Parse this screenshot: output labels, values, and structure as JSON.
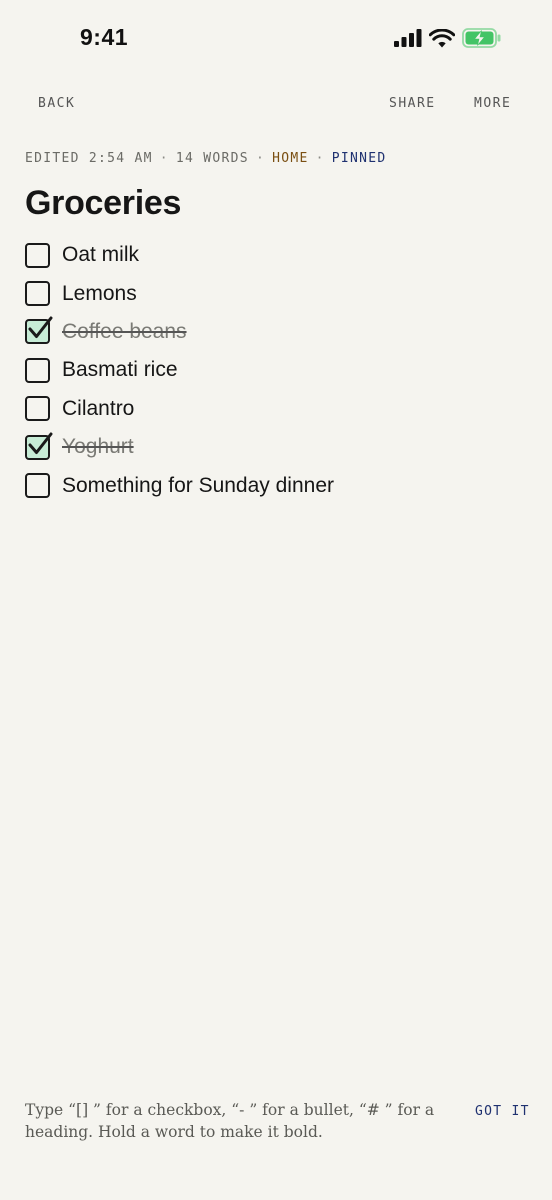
{
  "status_bar": {
    "time": "9:41",
    "battery_color": "#43c466"
  },
  "toolbar": {
    "back_label": "BACK",
    "share_label": "SHARE",
    "more_label": "MORE"
  },
  "meta": {
    "edited": "EDITED 2:54 AM",
    "separator": "·",
    "word_count": "14 WORDS",
    "tag_home": "HOME",
    "tag_pinned": "PINNED",
    "tag_home_color": "#7a4f12",
    "tag_pinned_color": "#1f3170"
  },
  "note": {
    "title": "Groceries",
    "items": [
      {
        "label": "Oat milk",
        "checked": false
      },
      {
        "label": "Lemons",
        "checked": false
      },
      {
        "label": "Coffee beans",
        "checked": true
      },
      {
        "label": "Basmati rice",
        "checked": false
      },
      {
        "label": "Cilantro",
        "checked": false
      },
      {
        "label": "Yoghurt",
        "checked": true
      },
      {
        "label": "Something for Sunday dinner",
        "checked": false
      }
    ]
  },
  "hint": {
    "text": "Type “[] ” for a checkbox, “- ” for a bullet, “# ” for a heading. Hold a word to make it bold.",
    "dismiss_label": "GOT IT"
  }
}
